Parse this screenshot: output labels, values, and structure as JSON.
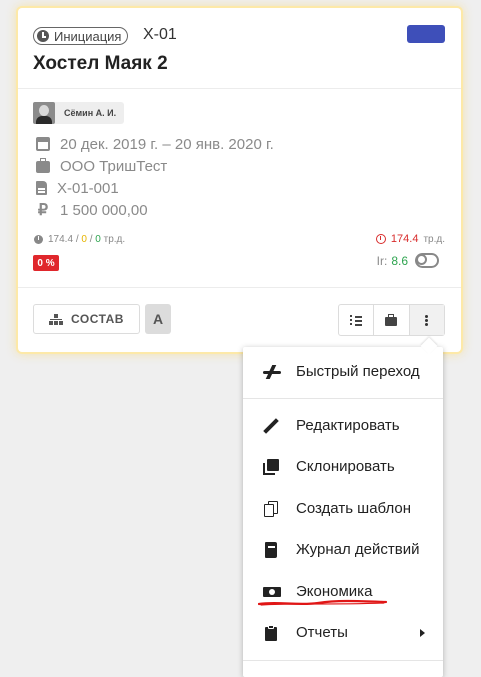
{
  "card": {
    "stage_label": "Инициация",
    "code": "Х-01",
    "title": "Хостел Маяк 2",
    "color_tag": "#3e4fb9",
    "user_name": "Сёмин А. И.",
    "dates": "20 дек. 2019 г. – 20 янв. 2020 г.",
    "company": "ООО ТришТест",
    "doc_number": "Х-01-001",
    "currency_symbol": "₽",
    "amount": "1 500 000,00",
    "stats_left": {
      "total": "174.4",
      "slash1": "/",
      "yellow": "0",
      "slash2": "/",
      "green": "0",
      "unit": "тр.д."
    },
    "stats_right": {
      "value": "174.4",
      "unit": "тр.д."
    },
    "percent_badge": "0 %",
    "ir_label": "Ir:",
    "ir_value": "8.6",
    "composition_button": "СОСТАВ",
    "letter_button": "А"
  },
  "menu": {
    "items": [
      {
        "label": "Быстрый переход",
        "icon": "airplane-icon"
      },
      {
        "label": "Редактировать",
        "icon": "pencil-icon"
      },
      {
        "label": "Склонировать",
        "icon": "clone-icon"
      },
      {
        "label": "Создать шаблон",
        "icon": "copy-icon"
      },
      {
        "label": "Журнал действий",
        "icon": "book-icon"
      },
      {
        "label": "Экономика",
        "icon": "money-icon"
      },
      {
        "label": "Отчеты",
        "icon": "clipboard-icon"
      }
    ]
  },
  "colors": {
    "accent_blue": "#3e4fb9",
    "danger_red": "#e0272c",
    "ok_green": "#2ea44f",
    "warn_yellow": "#e6b400",
    "card_glow": "#fde9a8"
  }
}
